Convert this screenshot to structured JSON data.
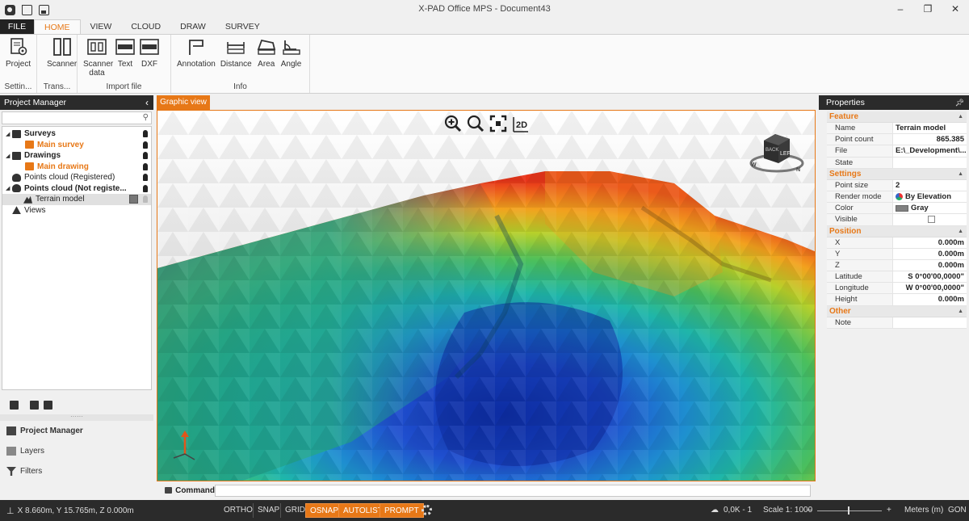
{
  "window": {
    "title": "X-PAD Office MPS - Document43",
    "minimize": "–",
    "restore": "❐",
    "close": "✕"
  },
  "menu": {
    "tabs": [
      "FILE",
      "HOME",
      "VIEW",
      "CLOUD",
      "DRAW",
      "SURVEY"
    ],
    "active": "HOME"
  },
  "ribbon": {
    "groups": [
      {
        "label": "Settin...",
        "buttons": [
          "Project"
        ]
      },
      {
        "label": "Trans...",
        "buttons": [
          "Scanner"
        ]
      },
      {
        "label": "Import file",
        "buttons": [
          "Scanner data",
          "Text",
          "DXF"
        ]
      },
      {
        "label": "Info",
        "buttons": [
          "Annotation",
          "Distance",
          "Area",
          "Angle"
        ]
      }
    ]
  },
  "project_manager": {
    "title": "Project Manager",
    "search_placeholder": "",
    "tree": [
      {
        "label": "Surveys",
        "style": "bold"
      },
      {
        "label": "Main survey",
        "style": "orange"
      },
      {
        "label": "Drawings",
        "style": "bold"
      },
      {
        "label": "Main drawing",
        "style": "orange"
      },
      {
        "label": "Points cloud (Registered)",
        "style": "normal"
      },
      {
        "label": "Points cloud (Not registe...",
        "style": "bold"
      },
      {
        "label": "Terrain model",
        "style": "selected"
      },
      {
        "label": "Views",
        "style": "normal"
      }
    ],
    "nav": [
      "Project Manager",
      "Layers",
      "Filters"
    ]
  },
  "graphic_view": {
    "tab": "Graphic view",
    "toolbar_2d": "2D",
    "cube": {
      "face_front": "LEFT",
      "face_side": "BACK",
      "compass_n": "N",
      "compass_w": "W"
    }
  },
  "command": {
    "label": "Command",
    "value": ""
  },
  "properties": {
    "title": "Properties",
    "sections": [
      {
        "name": "Feature",
        "rows": [
          {
            "key": "Name",
            "value": "Terrain model"
          },
          {
            "key": "Point count",
            "value": "865.385"
          },
          {
            "key": "File",
            "value": "E:\\_Development\\..."
          },
          {
            "key": "State",
            "value": ""
          }
        ]
      },
      {
        "name": "Settings",
        "rows": [
          {
            "key": "Point size",
            "value": "2"
          },
          {
            "key": "Render mode",
            "value": "By Elevation"
          },
          {
            "key": "Color",
            "value": "Gray"
          },
          {
            "key": "Visible",
            "value": ""
          }
        ]
      },
      {
        "name": "Position",
        "rows": [
          {
            "key": "X",
            "value": "0.000m"
          },
          {
            "key": "Y",
            "value": "0.000m"
          },
          {
            "key": "Z",
            "value": "0.000m"
          },
          {
            "key": "Latitude",
            "value": "S 0°00'00,0000\""
          },
          {
            "key": "Longitude",
            "value": "W 0°00'00,0000\""
          },
          {
            "key": "Height",
            "value": "0.000m"
          }
        ]
      },
      {
        "name": "Other",
        "rows": [
          {
            "key": "Note",
            "value": ""
          }
        ]
      }
    ]
  },
  "statusbar": {
    "coords": "X 8.660m, Y 15.765m, Z 0.000m",
    "toggles": [
      {
        "label": "ORTHO",
        "on": false
      },
      {
        "label": "SNAP",
        "on": false
      },
      {
        "label": "GRID",
        "on": false
      },
      {
        "label": "OSNAP",
        "on": true
      },
      {
        "label": "AUTOLIST",
        "on": true
      },
      {
        "label": "PROMPT",
        "on": true
      }
    ],
    "cloud": "0,0K - 1",
    "scale": "Scale 1: 1000",
    "slider_minus": "–",
    "slider_plus": "+",
    "units": "Meters (m)",
    "angle": "GON"
  },
  "colors": {
    "accent": "#e77817",
    "dark": "#2b2b2b"
  }
}
